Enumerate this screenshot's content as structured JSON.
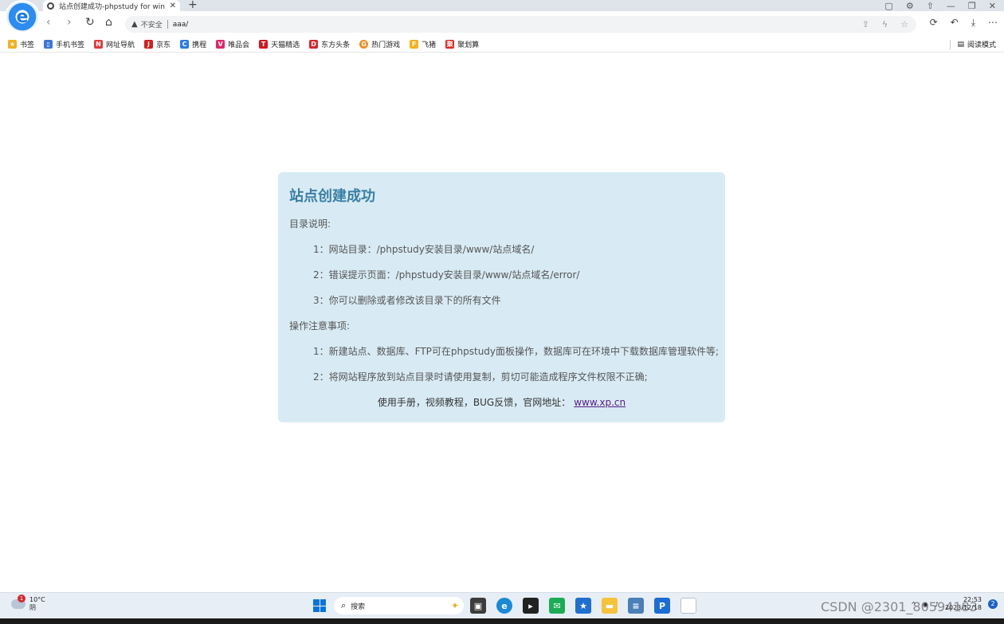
{
  "browser": {
    "tab_title": "站点创建成功-phpstudy for win",
    "tab_close": "✕",
    "new_tab": "+",
    "address": {
      "insecure_label": "不安全",
      "url": "aaa/"
    },
    "window_controls": [
      "—",
      "❐",
      "✕"
    ]
  },
  "bookmarks": {
    "items": [
      {
        "label": "书签",
        "icon": "star-icon",
        "color": "#f2b01e",
        "glyph": "★"
      },
      {
        "label": "手机书签",
        "icon": "phone-icon",
        "color": "#3a78d6",
        "glyph": "▯"
      },
      {
        "label": "网址导航",
        "icon": "navigation-icon",
        "color": "#e23a3a",
        "glyph": "N"
      },
      {
        "label": "京东",
        "icon": "jd-icon",
        "color": "#d71c1c",
        "glyph": "J"
      },
      {
        "label": "携程",
        "icon": "ctrip-icon",
        "color": "#2a7be4",
        "glyph": "C"
      },
      {
        "label": "唯品会",
        "icon": "vip-icon",
        "color": "#e3246a",
        "glyph": "V"
      },
      {
        "label": "天猫精选",
        "icon": "tmall-icon",
        "color": "#d4151d",
        "glyph": "T"
      },
      {
        "label": "东方头条",
        "icon": "news-icon",
        "color": "#d7262c",
        "glyph": "D"
      },
      {
        "label": "热门游戏",
        "icon": "game-icon",
        "color": "#f08a1c",
        "glyph": "G"
      },
      {
        "label": "飞猪",
        "icon": "fliggy-icon",
        "color": "#f5b21d",
        "glyph": "F"
      },
      {
        "label": "聚划算",
        "icon": "juhuasuan-icon",
        "color": "#e1251b",
        "glyph": "聚"
      }
    ],
    "reading_mode": "阅读模式"
  },
  "page": {
    "title": "站点创建成功",
    "dir_heading": "目录说明:",
    "dir_items": [
      "1：网站目录：/phpstudy安装目录/www/站点域名/",
      "2：错误提示页面：/phpstudy安装目录/www/站点域名/error/",
      "3：你可以删除或者修改该目录下的所有文件"
    ],
    "ops_heading": "操作注意事项:",
    "ops_items": [
      "1：新建站点、数据库、FTP可在phpstudy面板操作，数据库可在环境中下载数据库管理软件等;",
      "2：将网站程序放到站点目录时请使用复制，剪切可能造成程序文件权限不正确;"
    ],
    "footer_text": "使用手册，视频教程，BUG反馈，官网地址：",
    "footer_link": "www.xp.cn"
  },
  "taskbar": {
    "weather_temp": "10°C",
    "weather_desc": "阴",
    "weather_badge": "1",
    "search_placeholder": "搜索",
    "clock_time": "22:53",
    "clock_date": "2023/12/18",
    "notification_count": "2"
  },
  "watermark": "CSDN @2301_80594183"
}
